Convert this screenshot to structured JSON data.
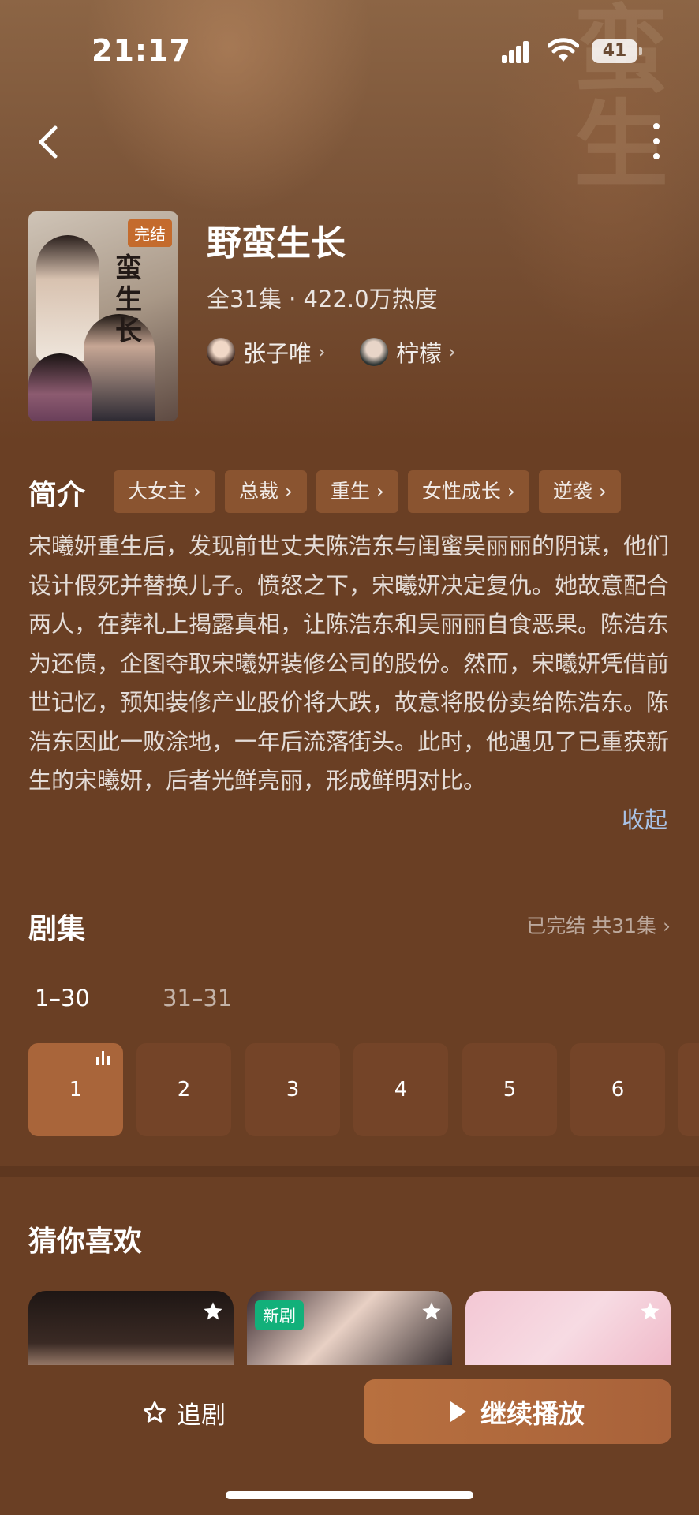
{
  "status_bar": {
    "time": "21:17",
    "battery": "41"
  },
  "drama": {
    "poster_badge": "完结",
    "poster_title": "蛮生长",
    "title": "野蛮生长",
    "meta": "全31集 · 422.0万热度",
    "cast": [
      {
        "name": "张子唯"
      },
      {
        "name": "柠檬"
      }
    ]
  },
  "intro": {
    "label": "简介",
    "tags": [
      "大女主",
      "总裁",
      "重生",
      "女性成长",
      "逆袭"
    ],
    "text": "宋曦妍重生后，发现前世丈夫陈浩东与闺蜜吴丽丽的阴谋，他们设计假死并替换儿子。愤怒之下，宋曦妍决定复仇。她故意配合两人，在葬礼上揭露真相，让陈浩东和吴丽丽自食恶果。陈浩东为还债，企图夺取宋曦妍装修公司的股份。然而，宋曦妍凭借前世记忆，预知装修产业股价将大跌，故意将股份卖给陈浩东。陈浩东因此一败涂地，一年后流落街头。此时，他遇见了已重获新生的宋曦妍，后者光鲜亮丽，形成鲜明对比。",
    "collapse_label": "收起"
  },
  "episodes": {
    "label": "剧集",
    "status": "已完结 共31集 ›",
    "ranges": [
      "1–30",
      "31–31"
    ],
    "items": [
      "1",
      "2",
      "3",
      "4",
      "5",
      "6"
    ]
  },
  "recommend": {
    "label": "猜你喜欢",
    "new_badge": "新剧"
  },
  "bottom": {
    "follow_label": "追剧",
    "play_label": "继续播放"
  }
}
